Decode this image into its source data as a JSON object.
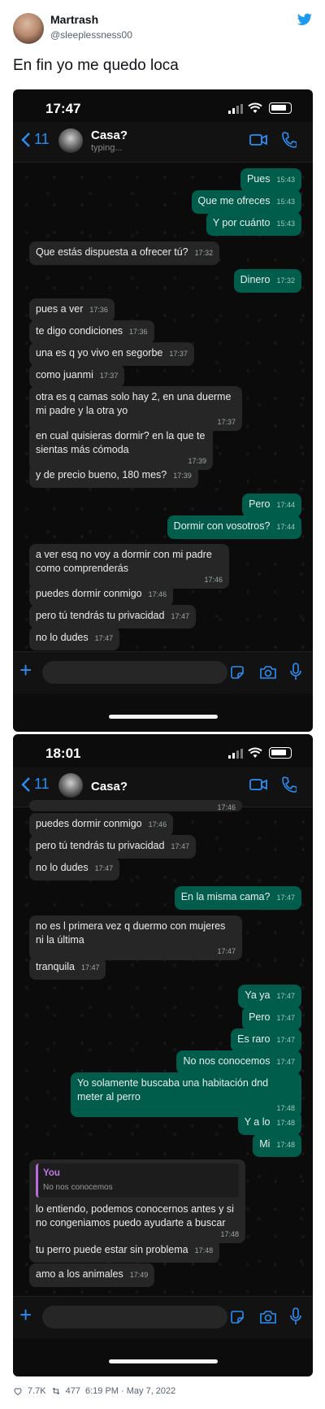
{
  "tweet": {
    "name": "Martrash",
    "handle": "@sleeplessness00",
    "text": "En fin yo me quedo loca",
    "likes": "7.7K",
    "retweets": "477",
    "date": "6:19 PM · May 7, 2022"
  },
  "colors": {
    "accent": "#2b8ef5",
    "outgoing": "#005c4b",
    "incoming": "#262626",
    "quote_bar": "#b96be0"
  },
  "shot1": {
    "time": "17:47",
    "back_count": "11",
    "contact": "Casa?",
    "status": "typing...",
    "messages": [
      {
        "text": "Pues",
        "time": "15:43"
      },
      {
        "text": "Que me ofreces",
        "time": "15:43"
      },
      {
        "text": "Y por cuánto",
        "time": "15:43"
      },
      {
        "text": "Que estás dispuesta a ofrecer tú?",
        "time": "17:32"
      },
      {
        "text": "Dinero",
        "time": "17:32"
      },
      {
        "text": "pues a ver",
        "time": "17:36"
      },
      {
        "text": "te digo condiciones",
        "time": "17:36"
      },
      {
        "text": "una es q yo vivo en segorbe",
        "time": "17:37"
      },
      {
        "text": "como juanmi",
        "time": "17:37"
      },
      {
        "text": "otra es q camas solo hay 2, en una duerme mi padre y la otra yo",
        "time": "17:37"
      },
      {
        "text": "en cual quisieras dormir? en la que te sientas más cómoda",
        "time": "17:39"
      },
      {
        "text": "y de precio bueno, 180 mes?",
        "time": "17:39"
      },
      {
        "text": "Pero",
        "time": "17:44"
      },
      {
        "text": "Dormir con vosotros?",
        "time": "17:44"
      },
      {
        "text": "a ver esq no voy a dormir con mi padre como comprenderás",
        "time": "17:46"
      },
      {
        "text": "puedes dormir conmigo",
        "time": "17:46"
      },
      {
        "text": "pero tú tendrás tu privacidad",
        "time": "17:47"
      },
      {
        "text": "no lo dudes",
        "time": "17:47"
      }
    ]
  },
  "shot2": {
    "time": "18:01",
    "back_count": "11",
    "contact": "Casa?",
    "top_cut_time": "17:46",
    "messages": [
      {
        "text": "puedes dormir conmigo",
        "time": "17:46"
      },
      {
        "text": "pero tú tendrás tu privacidad",
        "time": "17:47"
      },
      {
        "text": "no lo dudes",
        "time": "17:47"
      },
      {
        "text": "En la misma cama?",
        "time": "17:47"
      },
      {
        "text": "no es l primera vez q duermo con mujeres ni la última",
        "time": "17:47"
      },
      {
        "text": "tranquila",
        "time": "17:47"
      },
      {
        "text": "Ya ya",
        "time": "17:47"
      },
      {
        "text": "Pero",
        "time": "17:47"
      },
      {
        "text": "Es raro",
        "time": "17:47"
      },
      {
        "text": "No nos conocemos",
        "time": "17:47"
      },
      {
        "text": "Yo solamente buscaba una habitación dnd meter al perro",
        "time": "17:48"
      },
      {
        "text": "Y a lo",
        "time": "17:48"
      },
      {
        "text": "Mi",
        "time": "17:48"
      },
      {
        "quote_name": "You",
        "quote_text": "No nos conocemos",
        "text": "lo entiendo, podemos conocernos antes y si no congeniamos puedo ayudarte a buscar",
        "time": "17:48"
      },
      {
        "text": "tu perro puede estar sin problema",
        "time": "17:48"
      },
      {
        "text": "amo a los animales",
        "time": "17:49"
      }
    ]
  }
}
